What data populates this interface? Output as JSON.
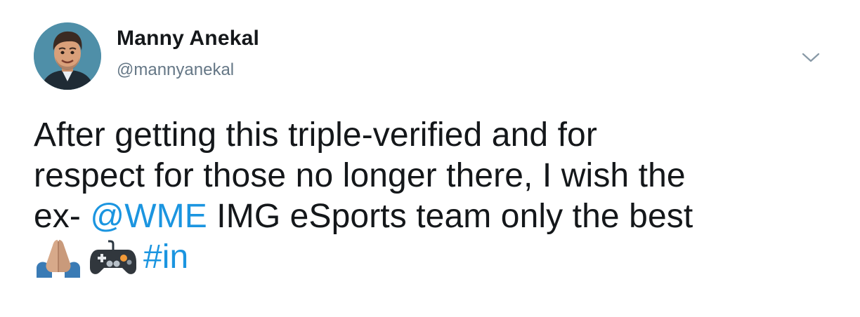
{
  "tweet": {
    "author_name": "Manny Anekal",
    "author_handle": "@mannyanekal",
    "text_line1": "After getting this triple-verified and for",
    "text_line2": "respect for those no longer there, I wish the",
    "text_line3_prefix": "ex- ",
    "mention": "@WME",
    "text_line3_suffix": " IMG eSports team only the best",
    "hashtag": "#in",
    "emojis": [
      "folded-hands-emoji",
      "video-game-emoji"
    ]
  },
  "colors": {
    "link": "#1b95e0",
    "text": "#14171a",
    "secondary": "#657786",
    "caret": "#8899a6"
  },
  "icons": {
    "menu": "chevron-down-icon"
  }
}
